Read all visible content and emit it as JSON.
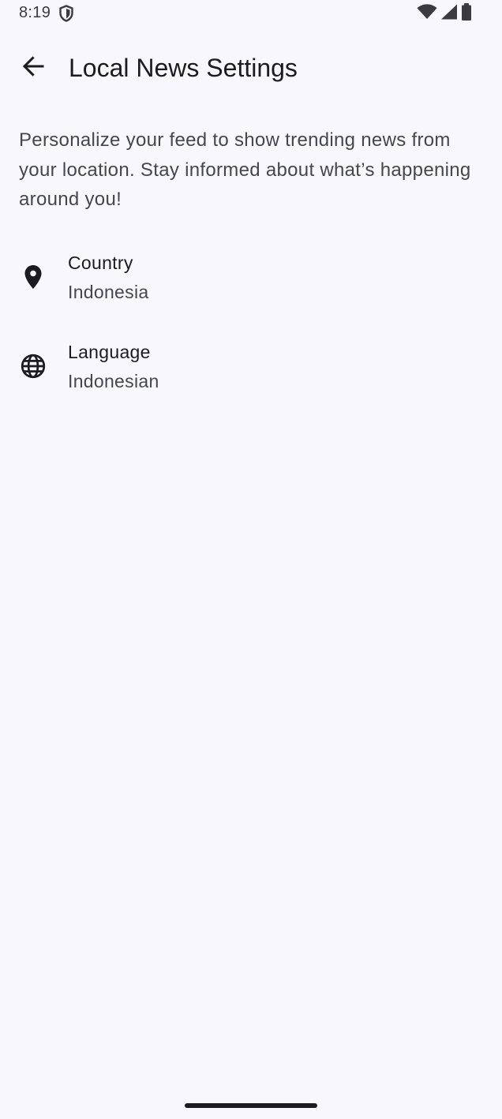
{
  "status_bar": {
    "time": "8:19",
    "icons": [
      "shield-icon",
      "wifi-icon",
      "cellular-signal-icon",
      "battery-icon"
    ]
  },
  "app_bar": {
    "back_icon": "arrow-back-icon",
    "title": "Local News Settings"
  },
  "description": "Personalize your feed to show trending news from your location. Stay informed about what’s happening around you!",
  "settings": [
    {
      "icon": "location-pin-icon",
      "label": "Country",
      "value": "Indonesia"
    },
    {
      "icon": "globe-icon",
      "label": "Language",
      "value": "Indonesian"
    }
  ],
  "colors": {
    "background": "#f8f7fd",
    "text_primary": "#1b1b21",
    "text_secondary": "#46464f"
  }
}
